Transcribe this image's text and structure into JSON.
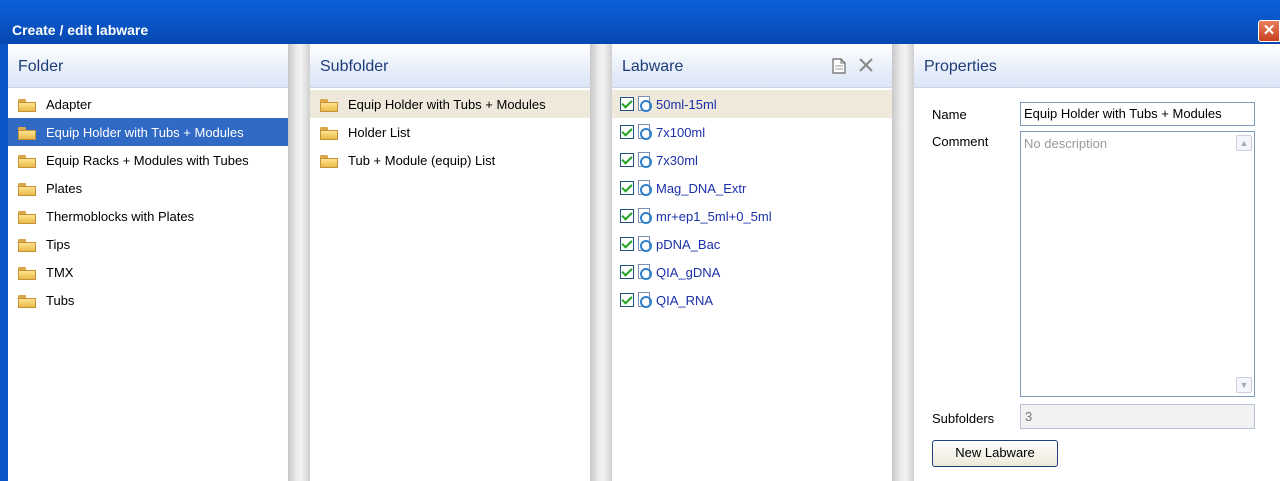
{
  "window": {
    "title": "Create / edit labware",
    "close_symbol": "✕"
  },
  "folder": {
    "header": "Folder",
    "items": [
      {
        "label": "Adapter"
      },
      {
        "label": "Equip Holder with Tubs + Modules"
      },
      {
        "label": "Equip Racks + Modules with Tubes"
      },
      {
        "label": "Plates"
      },
      {
        "label": "Thermoblocks with Plates"
      },
      {
        "label": "Tips"
      },
      {
        "label": "TMX"
      },
      {
        "label": "Tubs"
      }
    ],
    "selected_index": 1
  },
  "subfolder": {
    "header": "Subfolder",
    "items": [
      {
        "label": "Equip Holder with Tubs + Modules"
      },
      {
        "label": "Holder List"
      },
      {
        "label": "Tub + Module (equip) List"
      }
    ],
    "current_index": 0
  },
  "labware": {
    "header": "Labware",
    "new_icon": "new-document-icon",
    "delete_icon": "delete-icon",
    "items": [
      {
        "label": "50ml-15ml",
        "checked": true
      },
      {
        "label": "7x100ml",
        "checked": true
      },
      {
        "label": "7x30ml",
        "checked": true
      },
      {
        "label": "Mag_DNA_Extr",
        "checked": true
      },
      {
        "label": "mr+ep1_5ml+0_5ml",
        "checked": true
      },
      {
        "label": "pDNA_Bac",
        "checked": true
      },
      {
        "label": "QIA_gDNA",
        "checked": true
      },
      {
        "label": "QIA_RNA",
        "checked": true
      }
    ]
  },
  "properties": {
    "header": "Properties",
    "name_label": "Name",
    "name_value": "Equip Holder with Tubs + Modules",
    "comment_label": "Comment",
    "comment_placeholder": "No description",
    "subfolders_label": "Subfolders",
    "subfolders_value": "3",
    "new_labware_button": "New Labware"
  },
  "colors": {
    "titlebar": "#0a56c8",
    "selection": "#316ac5",
    "header_text": "#1d3c78",
    "labware_text": "#1a2fa8"
  }
}
